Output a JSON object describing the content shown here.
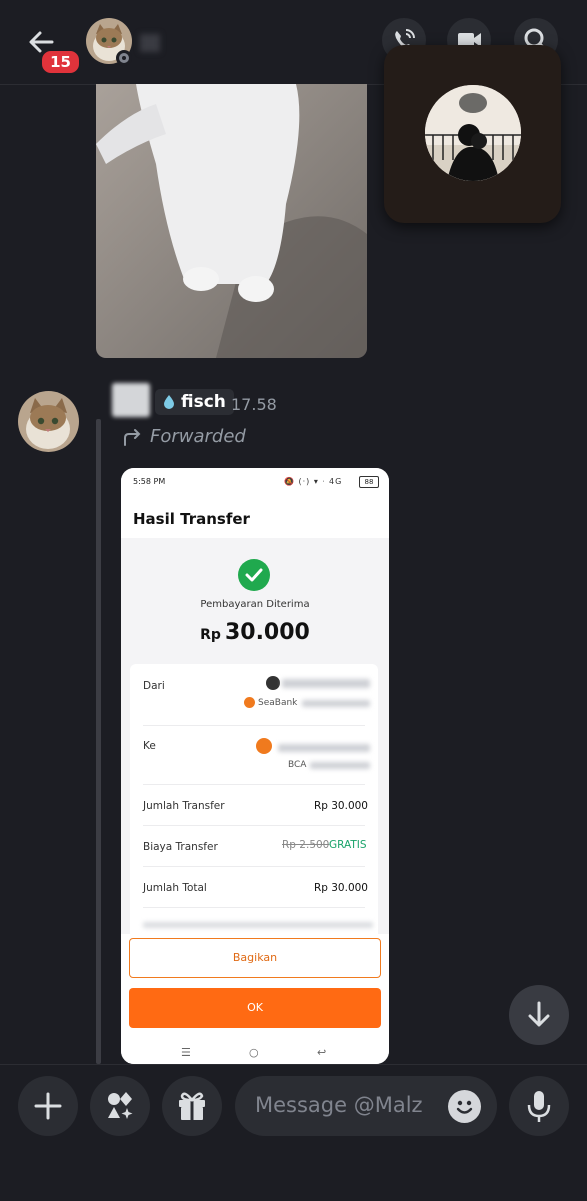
{
  "header": {
    "unread_count": "15"
  },
  "message": {
    "server_tag": "fisch",
    "time": "17.58",
    "forwarded_label": "Forwarded"
  },
  "receipt": {
    "status_time": "5:58 PM",
    "status_battery": "88",
    "title": "Hasil Transfer",
    "status_text": "Pembayaran Diterima",
    "currency": "Rp",
    "amount": "30.000",
    "rows": {
      "from_label": "Dari",
      "from_bank": "SeaBank",
      "to_label": "Ke",
      "to_bank": "BCA",
      "transfer_amount_label": "Jumlah Transfer",
      "transfer_amount_value": "Rp 30.000",
      "fee_label": "Biaya Transfer",
      "fee_original": "Rp 2.500",
      "fee_value": "GRATIS",
      "total_label": "Jumlah Total",
      "total_value": "Rp 30.000"
    },
    "share_button": "Bagikan",
    "ok_button": "OK"
  },
  "composer": {
    "placeholder": "Message @Malz"
  },
  "colors": {
    "background": "#1c1d23",
    "badge": "#e0333b",
    "accent_orange": "#ff6a13",
    "success_green": "#20a94e",
    "free_green": "#1aa36a"
  },
  "icons": [
    "back-arrow-icon",
    "phone-call-icon",
    "video-camera-icon",
    "search-icon",
    "forward-arrow-icon",
    "check-icon",
    "chevron-down-icon",
    "plus-icon",
    "apps-icon",
    "gift-icon",
    "emoji-icon",
    "microphone-icon"
  ]
}
